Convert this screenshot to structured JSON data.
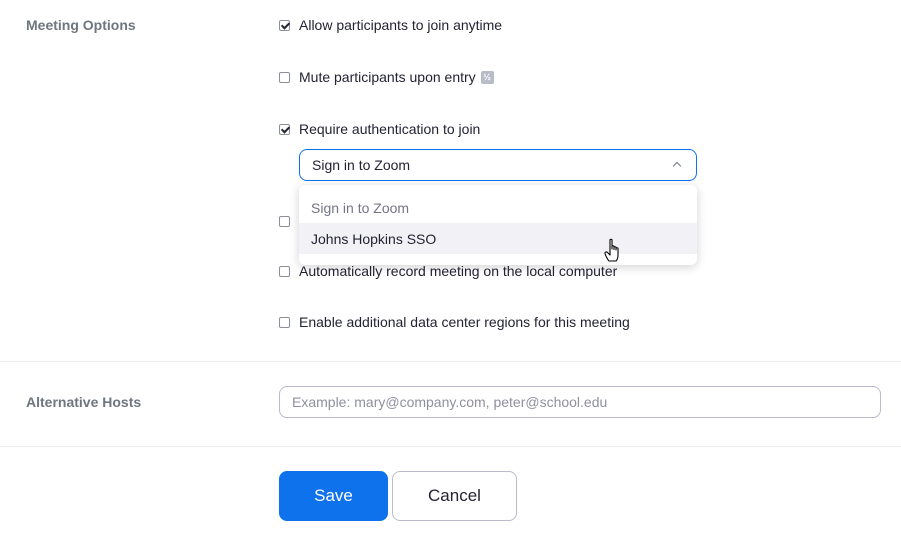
{
  "meeting_options": {
    "label": "Meeting Options",
    "options": [
      {
        "label": "Allow participants to join anytime",
        "checked": true
      },
      {
        "label": "Mute participants upon entry",
        "checked": false
      },
      {
        "label": "Require authentication to join",
        "checked": true
      },
      {
        "label": "",
        "checked": false
      },
      {
        "label": "Automatically record meeting on the local computer",
        "checked": false
      },
      {
        "label": "Enable additional data center regions for this meeting",
        "checked": false
      }
    ],
    "info_icon_glyph": "½",
    "auth_select": {
      "value": "Sign in to Zoom",
      "options": [
        "Sign in to Zoom",
        "Johns Hopkins SSO"
      ]
    }
  },
  "alternative_hosts": {
    "label": "Alternative Hosts",
    "placeholder": "Example: mary@company.com, peter@school.edu",
    "value": ""
  },
  "actions": {
    "save_label": "Save",
    "cancel_label": "Cancel"
  },
  "colors": {
    "primary": "#0e72ed",
    "label_gray": "#6e7680",
    "text": "#232333"
  },
  "icons": {
    "checkbox_checked": "checkmark-icon",
    "dropdown": "chevron-up-icon",
    "info": "info-icon",
    "cursor": "hand-pointer-icon"
  }
}
